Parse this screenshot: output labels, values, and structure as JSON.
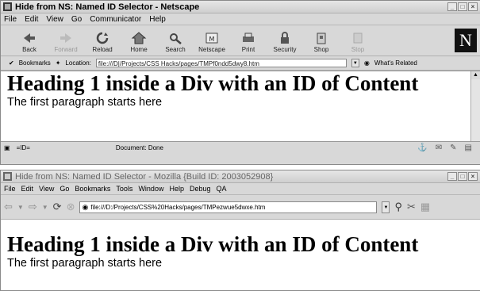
{
  "netscape": {
    "title": "Hide from NS: Named ID Selector - Netscape",
    "menu": [
      "File",
      "Edit",
      "View",
      "Go",
      "Communicator",
      "Help"
    ],
    "toolbar": [
      {
        "label": "Back",
        "icon": "back-arrow-icon",
        "disabled": false
      },
      {
        "label": "Forward",
        "icon": "forward-arrow-icon",
        "disabled": true
      },
      {
        "label": "Reload",
        "icon": "reload-icon",
        "disabled": false
      },
      {
        "label": "Home",
        "icon": "home-icon",
        "disabled": false
      },
      {
        "label": "Search",
        "icon": "search-icon",
        "disabled": false
      },
      {
        "label": "Netscape",
        "icon": "netscape-icon",
        "disabled": false
      },
      {
        "label": "Print",
        "icon": "print-icon",
        "disabled": false
      },
      {
        "label": "Security",
        "icon": "security-lock-icon",
        "disabled": false
      },
      {
        "label": "Shop",
        "icon": "shop-icon",
        "disabled": false
      },
      {
        "label": "Stop",
        "icon": "stop-icon",
        "disabled": true
      }
    ],
    "logo": "N",
    "bookmarks_label": "Bookmarks",
    "location_label": "Location:",
    "location_value": "file:///D|/Projects/CSS Hacks/pages/TMPf0ndd5dwy8.htm",
    "whats_related": "What's Related",
    "heading": "Heading 1 inside a Div with an ID of Content",
    "paragraph": "The first paragraph starts here",
    "status": "Document: Done"
  },
  "mozilla": {
    "title": "Hide from NS: Named ID Selector - Mozilla {Build ID: 2003052908}",
    "menu": [
      "File",
      "Edit",
      "View",
      "Go",
      "Bookmarks",
      "Tools",
      "Window",
      "Help",
      "Debug",
      "QA"
    ],
    "url": "file:///D:/Projects/CSS%20Hacks/pages/TMPezwue5dwxe.htm",
    "heading": "Heading 1 inside a Div with an ID of Content",
    "paragraph": "The first paragraph starts here"
  }
}
